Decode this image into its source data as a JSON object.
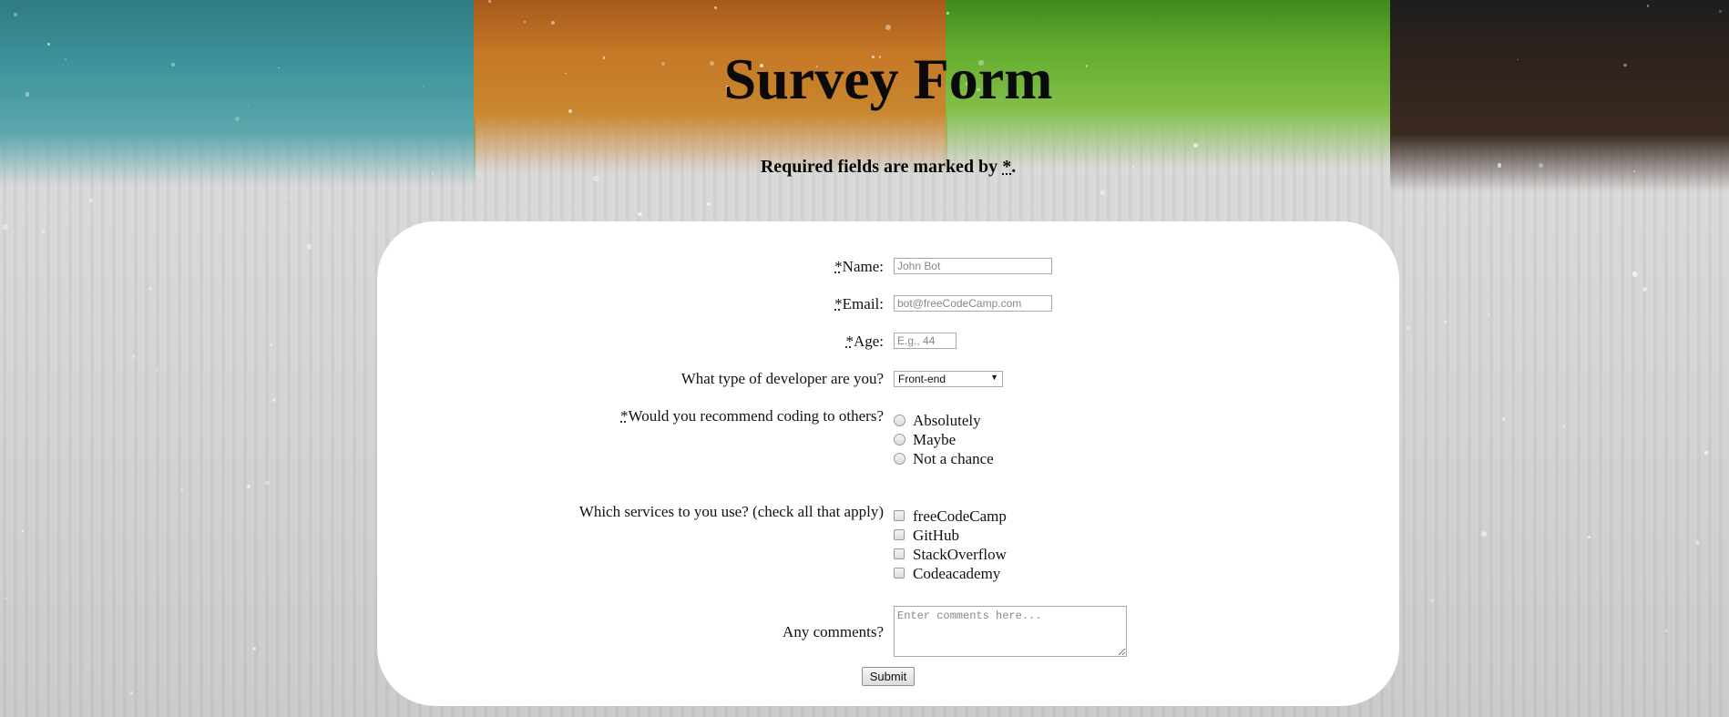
{
  "page": {
    "title": "Survey Form",
    "required_note_prefix": "Required fields are marked by ",
    "required_note_asterisk": "*",
    "required_note_suffix": "."
  },
  "form": {
    "required_marker": "*",
    "name": {
      "label": "Name:",
      "placeholder": "John Bot"
    },
    "email": {
      "label": "Email:",
      "placeholder": "bot@freeCodeCamp.com"
    },
    "age": {
      "label": "Age:",
      "placeholder": "E.g., 44"
    },
    "developer_type": {
      "label": "What type of developer are you?",
      "selected": "Front-end"
    },
    "recommend": {
      "label": "Would you recommend coding to others?",
      "options": [
        "Absolutely",
        "Maybe",
        "Not a chance"
      ]
    },
    "services": {
      "label": "Which services to you use? (check all that apply)",
      "options": [
        "freeCodeCamp",
        "GitHub",
        "StackOverflow",
        "Codeacademy"
      ]
    },
    "comments": {
      "label": "Any comments?",
      "placeholder": "Enter comments here..."
    },
    "submit_label": "Submit"
  },
  "colors": {
    "teal": "#3e949b",
    "orange": "#c57726",
    "green": "#64ad2e",
    "dark_brown": "#2d221c",
    "card": "#ffffff"
  }
}
